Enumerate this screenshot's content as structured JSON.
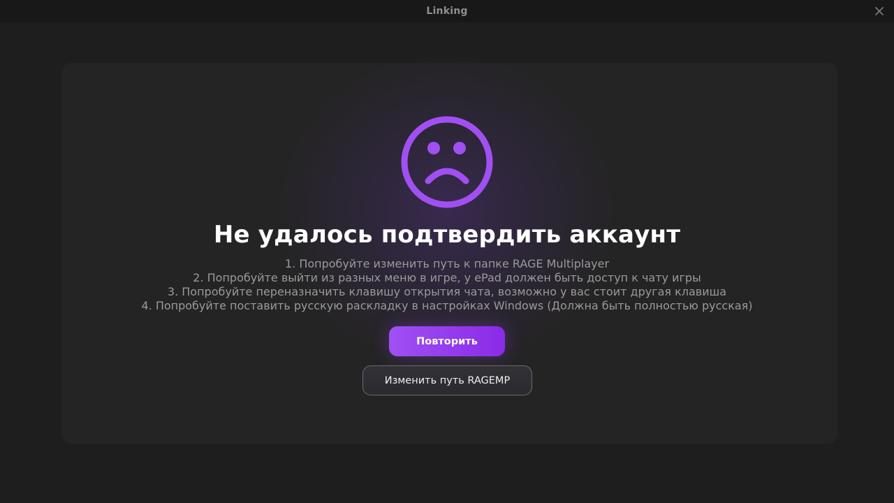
{
  "window": {
    "title": "Linking",
    "close_icon": "close-icon"
  },
  "error": {
    "icon": "sad-face-icon",
    "accent_color": "#a050f2",
    "heading": "Не удалось подтвердить аккаунт",
    "steps": [
      "1. Попробуйте изменить путь к папке RAGE Multiplayer",
      "2. Попробуйте выйти из разных меню в игре, у ePad должен быть доступ к чату игры",
      "3. Попробуйте переназначить клавишу открытия чата, возможно у вас стоит другая клавиша",
      "4. Попробуйте поставить русскую раскладку в настройках Windows (Должна быть полностью русская)"
    ]
  },
  "actions": {
    "retry_label": "Повторить",
    "change_path_label": "Изменить путь RAGEMP"
  }
}
